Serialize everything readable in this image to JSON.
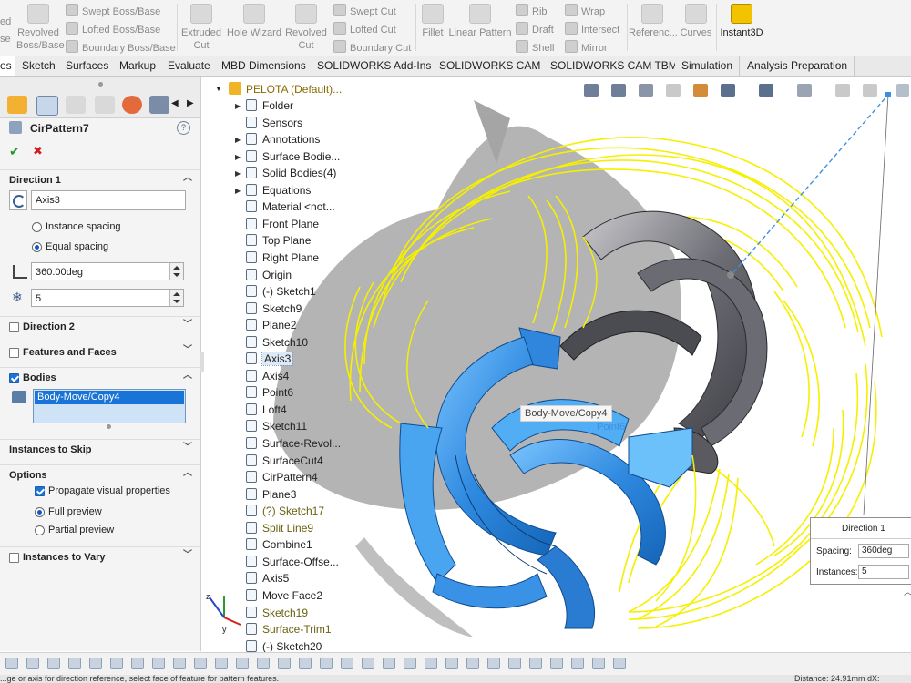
{
  "ribbon": {
    "left_partial": [
      "ed",
      "se"
    ],
    "revolved_boss": "Revolved Boss/Base",
    "swept_boss": "Swept Boss/Base",
    "lofted_boss": "Lofted Boss/Base",
    "boundary_boss": "Boundary Boss/Base",
    "extruded_cut": "Extruded Cut",
    "hole_wizard": "Hole Wizard",
    "revolved_cut": "Revolved Cut",
    "swept_cut": "Swept Cut",
    "lofted_cut": "Lofted Cut",
    "boundary_cut": "Boundary Cut",
    "fillet": "Fillet",
    "linear_pattern": "Linear Pattern",
    "rib": "Rib",
    "draft": "Draft",
    "shell": "Shell",
    "wrap": "Wrap",
    "intersect": "Intersect",
    "mirror": "Mirror",
    "reference": "Referenc...",
    "curves": "Curves",
    "instant3d": "Instant3D"
  },
  "tabs": [
    {
      "label": "es",
      "active": true
    },
    {
      "label": "Sketch"
    },
    {
      "label": "Surfaces"
    },
    {
      "label": "Markup"
    },
    {
      "label": "Evaluate"
    },
    {
      "label": "MBD Dimensions"
    },
    {
      "label": "SOLIDWORKS Add-Ins"
    },
    {
      "label": "SOLIDWORKS CAM"
    },
    {
      "label": "SOLIDWORKS CAM TBM"
    },
    {
      "label": "Simulation"
    },
    {
      "label": "Analysis Preparation"
    }
  ],
  "property_manager": {
    "title": "CirPattern7",
    "help": "?",
    "ok": "✔",
    "cancel": "✖",
    "direction1": {
      "header": "Direction 1",
      "axis": "Axis3",
      "instance_spacing": "Instance spacing",
      "equal_spacing": "Equal spacing",
      "angle": "360.00deg",
      "count": "5",
      "spacing_mode": "Equal spacing"
    },
    "direction2": {
      "header": "Direction 2",
      "enabled": false
    },
    "features_faces": {
      "header": "Features and Faces",
      "enabled": false
    },
    "bodies": {
      "header": "Bodies",
      "enabled": true,
      "selected": "Body-Move/Copy4"
    },
    "instances_to_skip": "Instances to Skip",
    "options": {
      "header": "Options",
      "propagate": "Propagate visual properties",
      "propagate_checked": true,
      "full_preview": "Full preview",
      "partial_preview": "Partial preview",
      "preview_mode": "Full preview"
    },
    "instances_to_vary": {
      "header": "Instances to Vary",
      "enabled": false
    }
  },
  "feature_tree": {
    "root": "PELOTA (Default)...",
    "items": [
      {
        "label": "Folder",
        "expandable": true,
        "icon": "folder-icon"
      },
      {
        "label": "Sensors",
        "icon": "sensor-icon"
      },
      {
        "label": "Annotations",
        "expandable": true,
        "icon": "annotations-icon"
      },
      {
        "label": "Surface Bodie...",
        "expandable": true,
        "icon": "surface-bodies-icon"
      },
      {
        "label": "Solid Bodies(4)",
        "expandable": true,
        "icon": "solid-bodies-icon"
      },
      {
        "label": "Equations",
        "expandable": true,
        "icon": "equations-icon"
      },
      {
        "label": "Material <not...",
        "icon": "material-icon"
      },
      {
        "label": "Front Plane",
        "icon": "plane-icon"
      },
      {
        "label": "Top Plane",
        "icon": "plane-icon"
      },
      {
        "label": "Right Plane",
        "icon": "plane-icon"
      },
      {
        "label": "Origin",
        "icon": "origin-icon"
      },
      {
        "label": "(-) Sketch1",
        "icon": "sketch-icon"
      },
      {
        "label": "Sketch9",
        "icon": "sketch-icon"
      },
      {
        "label": "Plane2",
        "icon": "plane-icon"
      },
      {
        "label": "Sketch10",
        "icon": "sketch-icon"
      },
      {
        "label": "Axis3",
        "icon": "axis-icon",
        "selected": true
      },
      {
        "label": "Axis4",
        "icon": "axis-icon"
      },
      {
        "label": "Point6",
        "icon": "point-icon"
      },
      {
        "label": "Loft4",
        "icon": "loft-icon"
      },
      {
        "label": "Sketch11",
        "icon": "sketch-icon"
      },
      {
        "label": "Surface-Revol...",
        "icon": "surface-revolve-icon"
      },
      {
        "label": "SurfaceCut4",
        "icon": "surface-cut-icon"
      },
      {
        "label": "CirPattern4",
        "icon": "circular-pattern-icon"
      },
      {
        "label": "Plane3",
        "icon": "plane-icon"
      },
      {
        "label": "(?) Sketch17",
        "icon": "sketch-warning-icon",
        "warn": true
      },
      {
        "label": "Split Line9",
        "icon": "split-line-icon",
        "warn": true
      },
      {
        "label": "Combine1",
        "icon": "combine-icon"
      },
      {
        "label": "Surface-Offse...",
        "icon": "surface-offset-icon"
      },
      {
        "label": "Axis5",
        "icon": "axis-icon"
      },
      {
        "label": "Move Face2",
        "icon": "move-face-icon"
      },
      {
        "label": "Sketch19",
        "icon": "sketch-warning-icon",
        "warn": true
      },
      {
        "label": "Surface-Trim1",
        "icon": "surface-trim-icon",
        "warn": true
      },
      {
        "label": "(-) Sketch20",
        "icon": "sketch-icon"
      }
    ]
  },
  "viewport": {
    "tooltip": "Body-Move/Copy4",
    "point_label": "Point6",
    "callout": {
      "title": "Direction 1",
      "spacing_label": "Spacing:",
      "spacing": "360deg",
      "instances_label": "Instances:",
      "instances": "5"
    },
    "colors": {
      "preview": "#f5f000",
      "selected": "#3f9be8",
      "body": "#5c5c66",
      "shadow": "#9a9a9a"
    }
  },
  "triad": {
    "x": "x",
    "y": "y",
    "z": "z"
  },
  "status_bar": {
    "message": "...ge or axis for direction reference, select face of feature for pattern features.",
    "distance": "Distance: 24.91mm  dX:"
  }
}
